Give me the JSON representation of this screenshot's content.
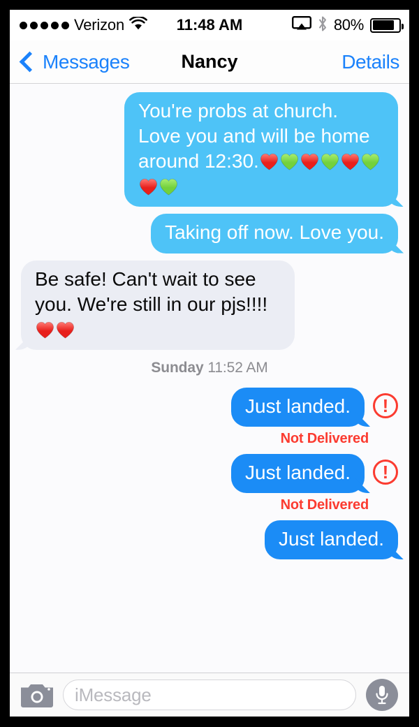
{
  "status_bar": {
    "signal_dots": 5,
    "carrier": "Verizon",
    "wifi_icon": "wifi-icon",
    "time": "11:48 AM",
    "airplay_icon": "airplay-icon",
    "bluetooth_icon": "bluetooth-icon",
    "battery_percent": "80%",
    "battery_level": 80
  },
  "nav_bar": {
    "back_label": "Messages",
    "back_icon": "chevron-left-icon",
    "title": "Nancy",
    "details_label": "Details"
  },
  "colors": {
    "bubble_sent_light": "#4ec3f7",
    "bubble_sent_strong": "#1b8cf6",
    "bubble_received": "#ebedf4",
    "accent_blue": "#1b82fb",
    "error_red": "#fb3b30",
    "heart_red": "#e8201c",
    "heart_green": "#73d13c",
    "background": "#fbfbfd"
  },
  "messages": [
    {
      "id": "msg-1",
      "side": "out",
      "tone": "light",
      "text": "You're probs at church. Love you and will be home around 12:30.",
      "hearts": [
        "red",
        "green",
        "red",
        "green",
        "red",
        "green",
        "red",
        "green"
      ],
      "status": null
    },
    {
      "id": "msg-2",
      "side": "out",
      "tone": "light",
      "text": "Taking off now.  Love you.",
      "hearts": [],
      "status": null
    },
    {
      "id": "msg-3",
      "side": "in",
      "tone": "received",
      "text": "Be safe! Can't wait to see you. We're still in our pjs!!!!",
      "hearts": [
        "red",
        "red"
      ],
      "status": null
    }
  ],
  "timestamp": {
    "day": "Sunday",
    "time": "11:52 AM"
  },
  "messages_after": [
    {
      "id": "msg-4",
      "side": "out",
      "tone": "strong",
      "text": "Just landed.",
      "hearts": [],
      "error_badge": "!",
      "status": "Not Delivered"
    },
    {
      "id": "msg-5",
      "side": "out",
      "tone": "strong",
      "text": "Just landed.",
      "hearts": [],
      "error_badge": "!",
      "status": "Not Delivered"
    },
    {
      "id": "msg-6",
      "side": "out",
      "tone": "strong",
      "text": "Just landed.",
      "hearts": [],
      "error_badge": null,
      "status": null
    }
  ],
  "input_bar": {
    "camera_icon": "camera-icon",
    "placeholder": "iMessage",
    "value": "",
    "mic_icon": "microphone-icon"
  }
}
